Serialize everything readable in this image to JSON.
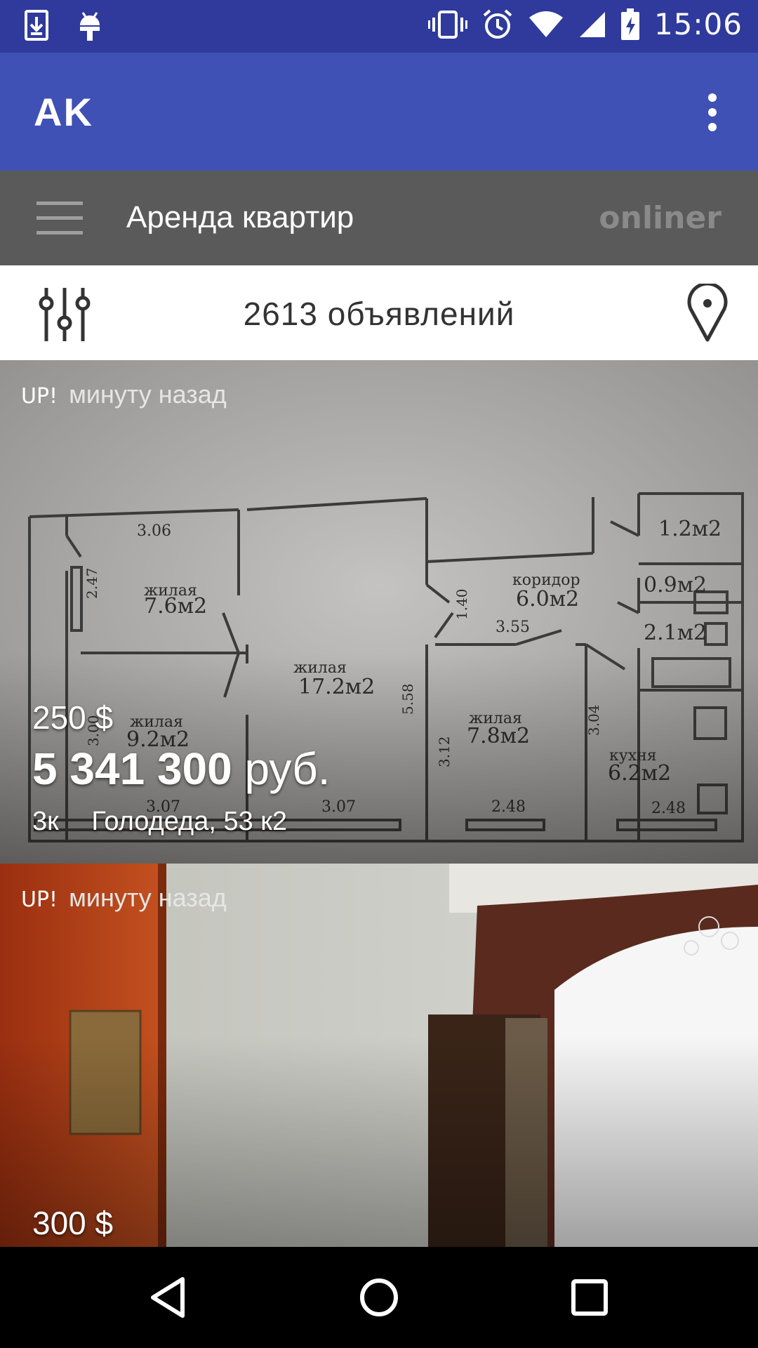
{
  "status_bar": {
    "time": "15:06",
    "left_icons": [
      "download-icon",
      "android-icon"
    ],
    "right_icons": [
      "vibrate-icon",
      "alarm-icon",
      "wifi-icon",
      "cell-signal-icon",
      "battery-charging-icon"
    ]
  },
  "app_bar": {
    "title": "AK",
    "overflow_icon": "more-vert-icon"
  },
  "category": {
    "title": "Аренда квартир",
    "brand": "onliner",
    "menu_icon": "hamburger-icon"
  },
  "filter_bar": {
    "count_label": "2613 объявлений",
    "filter_icon": "sliders-icon",
    "map_icon": "map-pin-icon"
  },
  "listings": [
    {
      "up_label": "UP!",
      "time_ago": "минуту назад",
      "price_usd": "250 $",
      "price_byr_number": "5 341 300",
      "price_byr_unit": "руб.",
      "rooms": "3к",
      "address": "Голодеда, 53 к2",
      "floorplan": {
        "rooms": [
          {
            "label": "жилая",
            "area": "7.6м2"
          },
          {
            "label": "жилая",
            "area": "17.2м2"
          },
          {
            "label": "жилая",
            "area": "9.2м2"
          },
          {
            "label": "коридор",
            "area": "6.0м2"
          },
          {
            "label": "жилая",
            "area": "7.8м2"
          },
          {
            "label": "кухня",
            "area": "6.2м2"
          },
          {
            "label": "",
            "area": "1.2м2"
          },
          {
            "label": "",
            "area": "0.9м2"
          },
          {
            "label": "",
            "area": "2.1м2"
          }
        ],
        "dimensions": [
          "3.06",
          "2.47",
          "1.40",
          "3.55",
          "5.58",
          "3.12",
          "3.04",
          "3.00",
          "3.07",
          "3.07",
          "2.48",
          "2.48"
        ]
      }
    },
    {
      "up_label": "UP!",
      "time_ago": "минуту назад",
      "price_usd": "300 $"
    }
  ],
  "nav_bar": {
    "icons": [
      "back-icon",
      "home-icon",
      "recents-icon"
    ]
  }
}
